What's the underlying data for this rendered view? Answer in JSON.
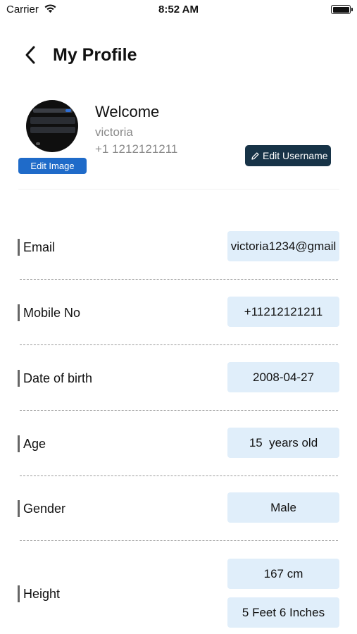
{
  "status_bar": {
    "carrier": "Carrier",
    "time": "8:52 AM",
    "battery_level": 1.0
  },
  "header": {
    "title": "My Profile",
    "back_icon": "chevron-left-icon"
  },
  "profile": {
    "welcome": "Welcome",
    "username": "victoria",
    "phone": "+1 1212121211",
    "edit_image_label": "Edit Image",
    "edit_username_label": "Edit Username",
    "edit_username_icon": "pencil-icon"
  },
  "fields": {
    "email": {
      "label": "Email",
      "value": "victoria1234@gmail"
    },
    "mobile": {
      "label": "Mobile No",
      "value": "+11212121211"
    },
    "dob": {
      "label": "Date of birth",
      "value": "2008-04-27"
    },
    "age": {
      "label": "Age",
      "value": "15  years old"
    },
    "gender": {
      "label": "Gender",
      "value": "Male"
    },
    "height": {
      "label": "Height",
      "value_cm": "167 cm",
      "value_ft": "5 Feet 6 Inches"
    }
  },
  "colors": {
    "primary_button": "#1f6bc9",
    "dark_button": "#173347",
    "value_box": "#e0eefa",
    "muted_text": "#8a8a8a"
  }
}
